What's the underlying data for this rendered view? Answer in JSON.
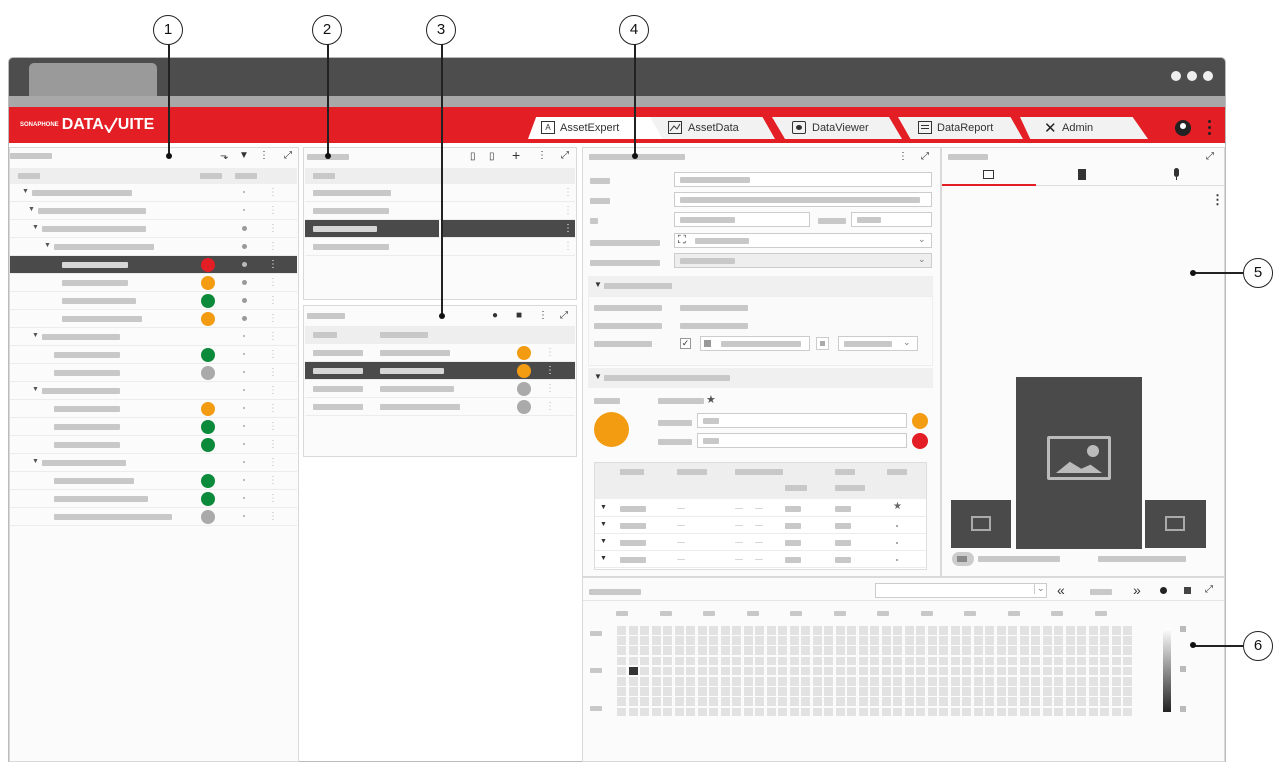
{
  "app": {
    "brand_prefix": "SONAPHONE",
    "brand_name": "DATA",
    "brand_suffix": "UITE"
  },
  "tabs": [
    {
      "label": "AssetExpert",
      "icon": "asset-expert-icon",
      "active": true
    },
    {
      "label": "AssetData",
      "icon": "chart-icon",
      "active": false
    },
    {
      "label": "DataViewer",
      "icon": "eye-icon",
      "active": false
    },
    {
      "label": "DataReport",
      "icon": "report-icon",
      "active": false
    },
    {
      "label": "Admin",
      "icon": "tools-icon",
      "active": false
    }
  ],
  "callouts": [
    "1",
    "2",
    "3",
    "4",
    "5",
    "6"
  ],
  "colors": {
    "brand_red": "#e31e24",
    "status_red": "#e31e24",
    "status_orange": "#f39c12",
    "status_green": "#0a8a3a",
    "status_gray": "#aaaaaa",
    "chrome_dark": "#4d4d4d",
    "selected_row": "#4a4a4a"
  },
  "tree_status": [
    "none",
    "none",
    "none",
    "none",
    "red",
    "orange",
    "green",
    "orange",
    "none",
    "green",
    "gray",
    "none",
    "orange",
    "green",
    "green",
    "none",
    "green",
    "green",
    "gray"
  ],
  "list3_status": [
    "orange",
    "orange",
    "gray",
    "gray"
  ],
  "heatmap_highlight": {
    "row": 4,
    "col": 1
  }
}
